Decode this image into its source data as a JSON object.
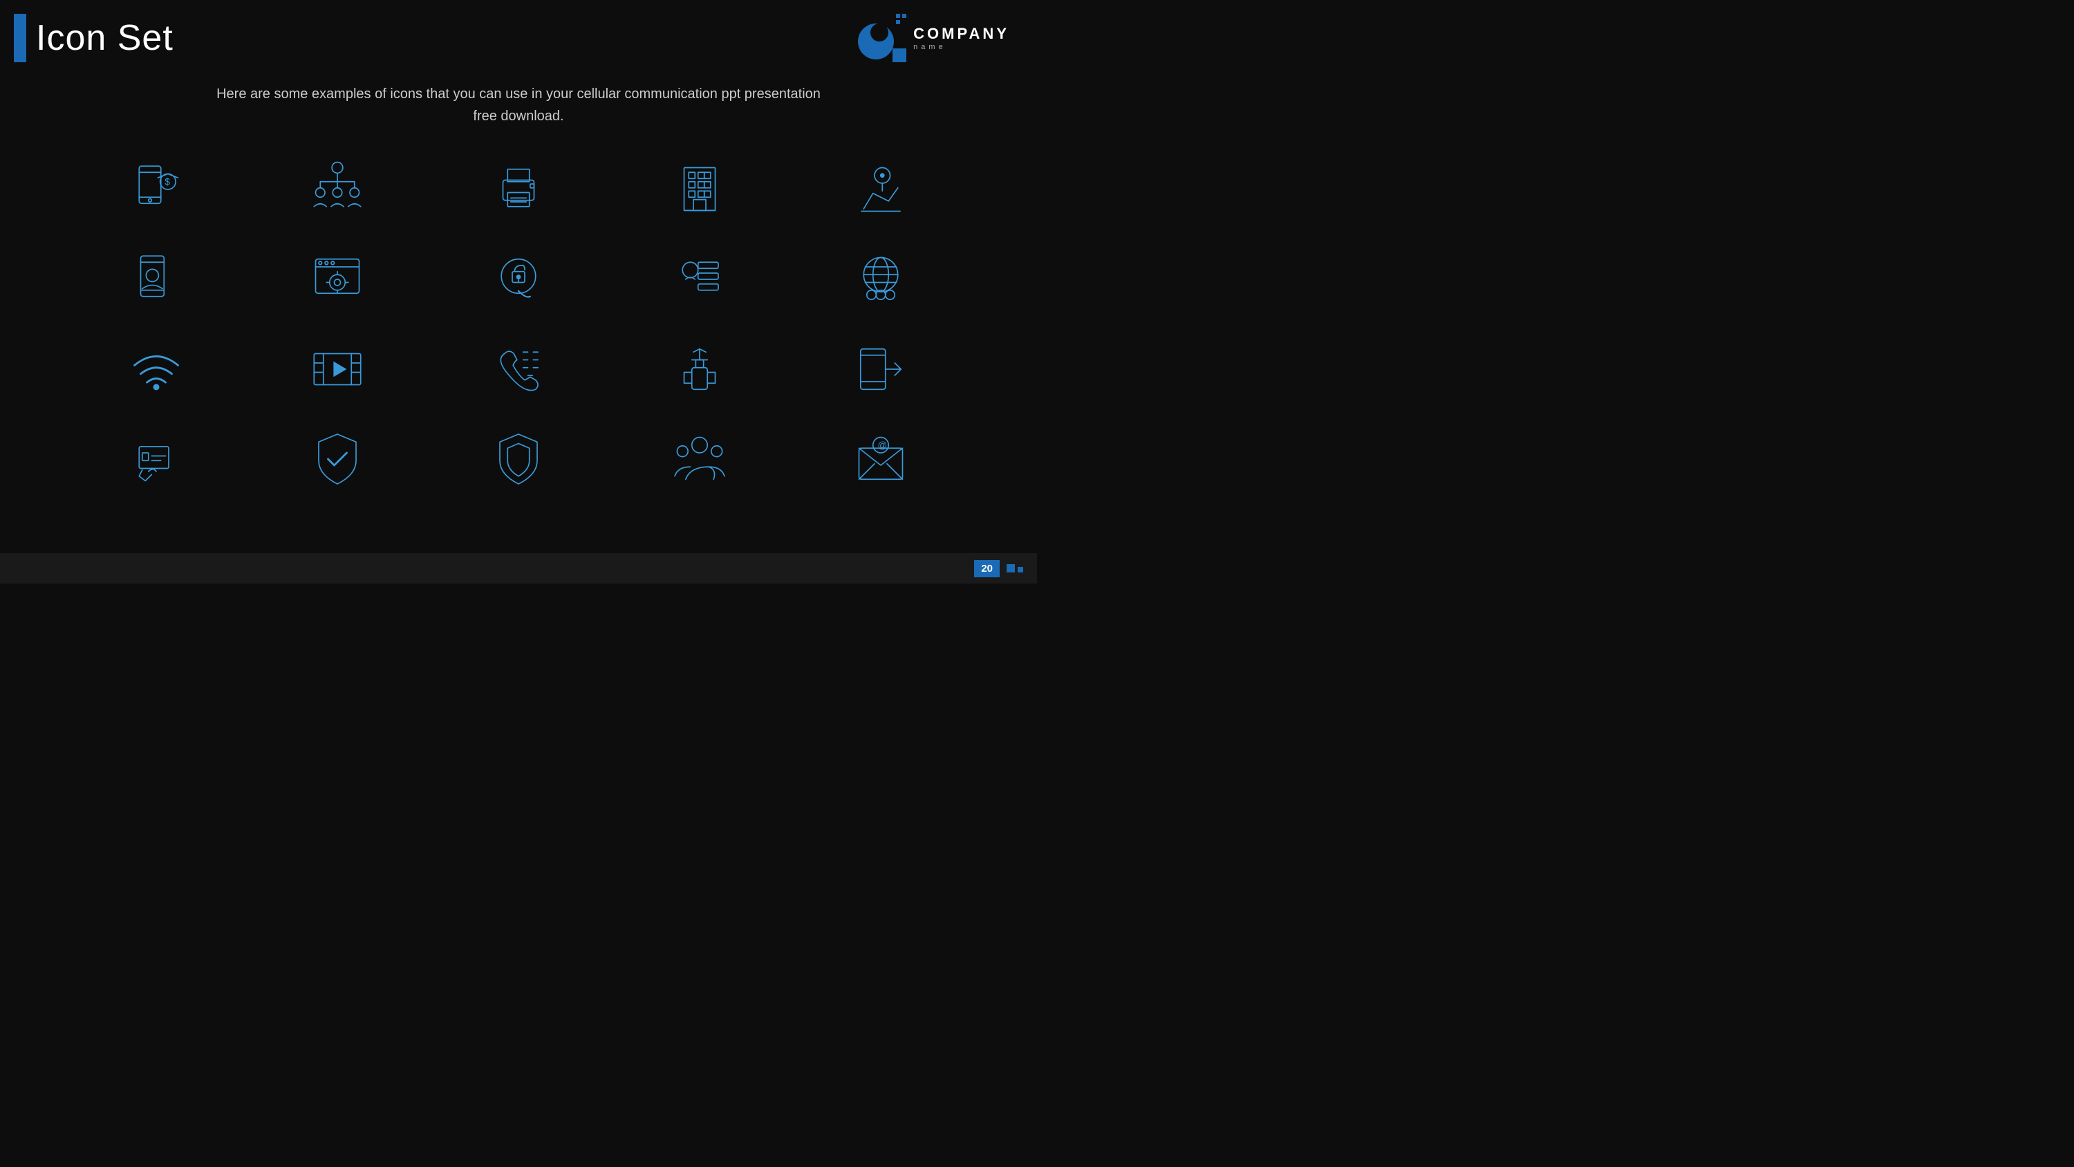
{
  "header": {
    "title": "Icon Set",
    "logo": {
      "company": "COMPANY",
      "sub": "name"
    }
  },
  "subtitle": {
    "text": "Here are some examples of icons that you can use in your cellular communication ppt presentation free download."
  },
  "footer": {
    "page_number": "20"
  },
  "icons": [
    {
      "name": "mobile-payment-icon",
      "row": 1,
      "col": 1
    },
    {
      "name": "team-hierarchy-icon",
      "row": 1,
      "col": 2
    },
    {
      "name": "printer-icon",
      "row": 1,
      "col": 3
    },
    {
      "name": "building-icon",
      "row": 1,
      "col": 4
    },
    {
      "name": "map-location-icon",
      "row": 1,
      "col": 5
    },
    {
      "name": "mobile-contact-icon",
      "row": 2,
      "col": 1
    },
    {
      "name": "browser-settings-icon",
      "row": 2,
      "col": 2
    },
    {
      "name": "security-lock-icon",
      "row": 2,
      "col": 3
    },
    {
      "name": "business-data-icon",
      "row": 2,
      "col": 4
    },
    {
      "name": "global-network-icon",
      "row": 2,
      "col": 5
    },
    {
      "name": "wifi-icon",
      "row": 3,
      "col": 1
    },
    {
      "name": "video-film-icon",
      "row": 3,
      "col": 2
    },
    {
      "name": "phone-keypad-icon",
      "row": 3,
      "col": 3
    },
    {
      "name": "power-tool-icon",
      "row": 3,
      "col": 4
    },
    {
      "name": "mobile-exit-icon",
      "row": 3,
      "col": 5
    },
    {
      "name": "secure-payment-icon",
      "row": 4,
      "col": 1
    },
    {
      "name": "shield-check-icon",
      "row": 4,
      "col": 2
    },
    {
      "name": "shield-icon",
      "row": 4,
      "col": 3
    },
    {
      "name": "team-group-icon",
      "row": 4,
      "col": 4
    },
    {
      "name": "email-icon",
      "row": 4,
      "col": 5
    }
  ]
}
